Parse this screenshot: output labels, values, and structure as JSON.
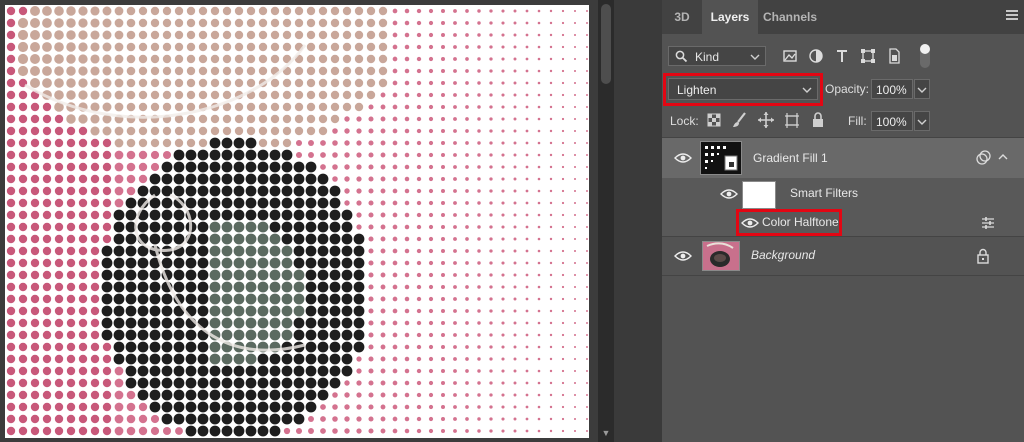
{
  "canvas": {
    "description_icon": "halftone-canvas"
  },
  "panel": {
    "tabs": [
      {
        "label": "3D",
        "active": false
      },
      {
        "label": "Layers",
        "active": true
      },
      {
        "label": "Channels",
        "active": false
      }
    ],
    "filter": {
      "kind_label": "Kind"
    },
    "blend_mode": "Lighten",
    "opacity_label": "Opacity:",
    "opacity_value": "100%",
    "lock_label": "Lock:",
    "fill_label": "Fill:",
    "fill_value": "100%",
    "layers": [
      {
        "name": "Gradient Fill 1",
        "selected": true
      },
      {
        "name": "Smart Filters"
      },
      {
        "name": "Color Halftone"
      },
      {
        "name": "Background",
        "italic": true
      }
    ]
  },
  "colors": {
    "highlight": "#e30613",
    "panel_bg": "#535353",
    "selected_row": "#696969",
    "canvas_bg": "#3c3c3c",
    "dot_pink": "#d4728f",
    "dot_dark": "#1e1e1e"
  }
}
